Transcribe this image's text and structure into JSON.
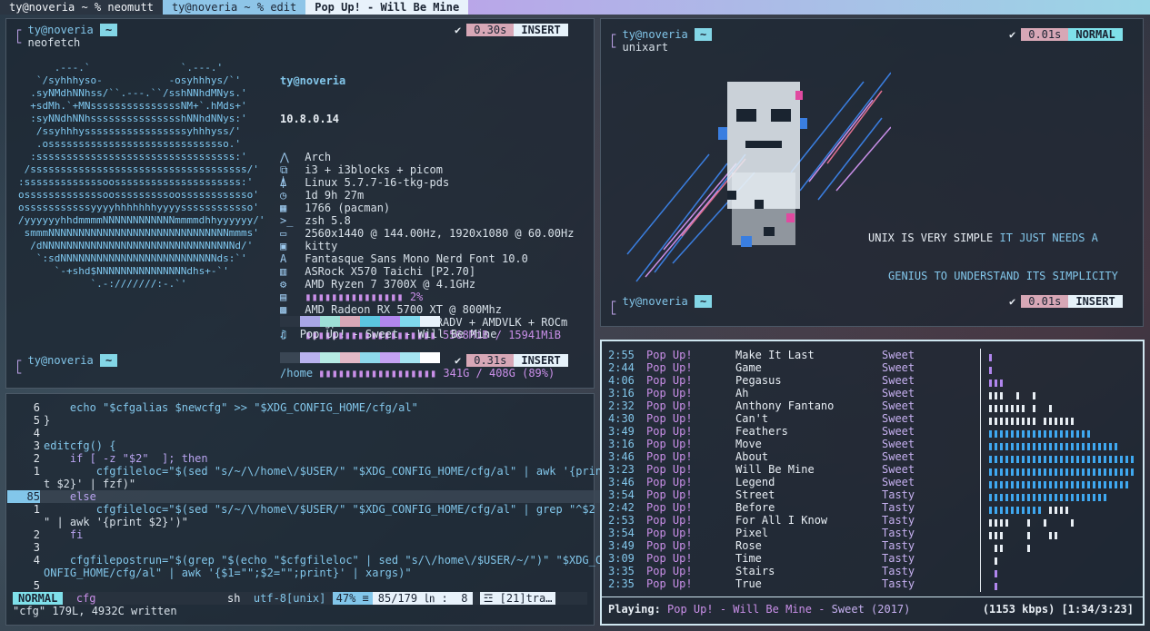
{
  "tabs": [
    {
      "label": "ty@noveria ~ % neomutt"
    },
    {
      "label": "ty@noveria ~ % edit"
    },
    {
      "label": "Pop Up! - Will Be Mine"
    }
  ],
  "colors": {
    "accent": "#82c6ea",
    "purple": "#c98fe8",
    "pink": "#d7a7b6"
  },
  "neofetch_pane": {
    "prompt_user": "ty@noveria",
    "prompt_dir": "~",
    "command": "neofetch",
    "time": "0.30s",
    "mode": "INSERT",
    "prompt2_user": "ty@noveria",
    "prompt2_dir": "~",
    "time2": "0.31s",
    "mode2": "INSERT",
    "check": "✔",
    "art": [
      "      .---.`               `.---.'",
      "   `/syhhhyso-           -osyhhhys/`'",
      "  .syNMdhNNhss/``.---.``/sshNNhdMNys.'",
      "  +sdMh.`+MNsssssssssssssssNM+`.hMds+'",
      "  :syNNdhNNhssssssssssssssshNNhdNNys:'",
      "   /ssyhhhysssssssssssssssssyhhhyss/'",
      "   .ossssssssssssssssssssssssssssso.'",
      "  :sssssssssssssssssssssssssssssssss:'",
      " /ssssssssssssssssssssssssssssssssssss/'",
      ":sssssssssssssoosssssssssssssssssssss:'",
      "osssssssssssssoosssssssssoossssssssssso'",
      "osssssssssssyyyyhhhhhhhyyyyssssssssssso'",
      "/yyyyyyhhdmmmmNNNNNNNNNNNNmmmmdhhyyyyyy/'",
      " smmmNNNNNNNNNNNNNNNNNNNNNNNNNNNNNNmmms'",
      "  /dNNNNNNNNNNNNNNNNNNNNNNNNNNNNNNNNd/'",
      "   `:sdNNNNNNNNNNNNNNNNNNNNNNNNNNds:`'",
      "      `-+shd$NNNNNNNNNNNNNNNdhs+-`'",
      "            `.-:///////:-.`'"
    ],
    "user_host": "ty@noveria",
    "version": "10.8.0.14",
    "info": [
      {
        "icon": "⋀",
        "value": "Arch"
      },
      {
        "icon": "⧉",
        "value": "i3 + i3blocks + picom"
      },
      {
        "icon": "⍋",
        "value": "Linux 5.7.7-16-tkg-pds"
      },
      {
        "icon": "◷",
        "value": "1d 9h 27m"
      },
      {
        "icon": "▦",
        "value": "1766 (pacman)"
      },
      {
        "icon": ">_",
        "value": "zsh 5.8"
      },
      {
        "icon": "▭",
        "value": "2560x1440 @ 144.00Hz, 1920x1080 @ 60.00Hz"
      },
      {
        "icon": "▣",
        "value": "kitty"
      },
      {
        "icon": "A",
        "value": "Fantasque Sans Mono Nerd Font 10.0"
      },
      {
        "icon": "▥",
        "value": "ASRock X570 Taichi [P2.70]"
      },
      {
        "icon": "⚙",
        "value": "AMD Ryzen 7 3700X @ 4.1GHz"
      },
      {
        "icon": "▤",
        "value": "▮▮▮▮▮▮▮▮▮▮▮▮▮▮▮ 2%"
      },
      {
        "icon": "▩",
        "value": "AMD Radeon RX 5700 XT @ 800Mhz"
      },
      {
        "icon": "◉",
        "value": "amdgpu + RadeonSI + RADV + AMDVLK + ROCm"
      },
      {
        "icon": "▯",
        "value": "▮▮▮▮▮▮▮▮▮▮▮▮▮▮▮▮▮▮▮▮ 5568MiB / 15941MiB"
      }
    ],
    "home_label": "/home",
    "home_value": "▮▮▮▮▮▮▮▮▮▮▮▮▮▮▮▮▮▮ 341G / 408G (89%)",
    "palette1": [
      "#2b3542",
      "#a8a6e6",
      "#9edfd6",
      "#d7a7b6",
      "#5bc6e0",
      "#b186ee",
      "#7fd8ec",
      "#e8f2fb"
    ],
    "palette2": [
      "#3a4654",
      "#b9b2ee",
      "#b6ece4",
      "#e3b9c6",
      "#8ed9ec",
      "#c4a2f2",
      "#a6e6f2",
      "#ffffff"
    ],
    "now_playing_icon": "♫",
    "now_playing": "Pop Up! - Sweet - Will Be Mine"
  },
  "unixart_pane": {
    "prompt_user": "ty@noveria",
    "prompt_dir": "~",
    "command": "unixart",
    "time": "0.01s",
    "mode": "NORMAL",
    "prompt2_user": "ty@noveria",
    "prompt2_dir": "~",
    "time2": "0.01s",
    "mode2": "INSERT",
    "quote_a": "UNIX IS VERY SIMPLE",
    "quote_b": "IT JUST NEEDS A",
    "quote_c": "GENIUS TO UNDERSTAND ITS SIMPLICITY"
  },
  "editor": {
    "lines": [
      {
        "n": "6",
        "html": "    echo \"$cfgalias $newcfg\" >> \"$XDG_CONFIG_HOME/cfg/al\""
      },
      {
        "n": "5",
        "html": "}"
      },
      {
        "n": "4",
        "html": ""
      },
      {
        "n": "3",
        "html": "editcfg() {"
      },
      {
        "n": "2",
        "html": "    if [ -z \"$2\"  ]; then"
      },
      {
        "n": "1",
        "html": "        cfgfileloc=\"$(sed \"s/~/\\/home\\/$USER/\" \"$XDG_CONFIG_HOME/cfg/al\" | awk '{prin"
      },
      {
        "n": "",
        "html": "t $2}' | fzf)\""
      },
      {
        "n": "85",
        "html": "    else"
      },
      {
        "n": "1",
        "html": "        cfgfileloc=\"$(sed \"s/~/\\/home\\/$USER/\" \"$XDG_CONFIG_HOME/cfg/al\" | grep \"^$2"
      },
      {
        "n": "",
        "html": "\" | awk '{print $2}')\""
      },
      {
        "n": "2",
        "html": "    fi"
      },
      {
        "n": "3",
        "html": ""
      },
      {
        "n": "4",
        "html": "    cfgfilepostrun=\"$(grep \"$(echo \"$cfgfileloc\" | sed \"s/\\/home\\/$USER/~/\")\" \"$XDG_C"
      },
      {
        "n": "",
        "html": "ONFIG_HOME/cfg/al\" | awk '{$1=\"\";$2=\"\";print}' | xargs)\""
      },
      {
        "n": "5",
        "html": ""
      }
    ],
    "status_mode": "NORMAL",
    "status_file": "cfg",
    "status_ft": "sh",
    "status_enc": "utf-8[unix]",
    "status_pct": "47% ≡",
    "status_pos": "85/179 ㏑ :  8",
    "status_extra": "☲ [21]tra…",
    "message": "\"cfg\" 179L, 4932C written"
  },
  "player": {
    "tracks": [
      {
        "time": "2:55",
        "artist": "Pop Up!",
        "title": "Make It Last",
        "album": "Sweet"
      },
      {
        "time": "2:44",
        "artist": "Pop Up!",
        "title": "Game",
        "album": "Sweet"
      },
      {
        "time": "4:06",
        "artist": "Pop Up!",
        "title": "Pegasus",
        "album": "Sweet"
      },
      {
        "time": "3:16",
        "artist": "Pop Up!",
        "title": "Ah",
        "album": "Sweet"
      },
      {
        "time": "2:32",
        "artist": "Pop Up!",
        "title": "Anthony Fantano",
        "album": "Sweet"
      },
      {
        "time": "4:30",
        "artist": "Pop Up!",
        "title": "Can't",
        "album": "Sweet"
      },
      {
        "time": "3:49",
        "artist": "Pop Up!",
        "title": "Feathers",
        "album": "Sweet"
      },
      {
        "time": "3:16",
        "artist": "Pop Up!",
        "title": "Move",
        "album": "Sweet"
      },
      {
        "time": "3:46",
        "artist": "Pop Up!",
        "title": "About",
        "album": "Sweet"
      },
      {
        "time": "3:23",
        "artist": "Pop Up!",
        "title": "Will Be Mine",
        "album": "Sweet"
      },
      {
        "time": "3:46",
        "artist": "Pop Up!",
        "title": "Legend",
        "album": "Sweet"
      },
      {
        "time": "3:54",
        "artist": "Pop Up!",
        "title": "Street",
        "album": "Tasty"
      },
      {
        "time": "2:42",
        "artist": "Pop Up!",
        "title": "Before",
        "album": "Tasty"
      },
      {
        "time": "2:53",
        "artist": "Pop Up!",
        "title": "For All I Know",
        "album": "Tasty"
      },
      {
        "time": "3:54",
        "artist": "Pop Up!",
        "title": "Pixel",
        "album": "Tasty"
      },
      {
        "time": "3:49",
        "artist": "Pop Up!",
        "title": "Rose",
        "album": "Tasty"
      },
      {
        "time": "3:09",
        "artist": "Pop Up!",
        "title": "Time",
        "album": "Tasty"
      },
      {
        "time": "3:35",
        "artist": "Pop Up!",
        "title": "Stairs",
        "album": "Tasty"
      },
      {
        "time": "2:35",
        "artist": "Pop Up!",
        "title": "True",
        "album": "Tasty"
      }
    ],
    "playing_label": "Playing:",
    "playing_track": "Pop Up! - Will Be Mine",
    "playing_sep": " - ",
    "playing_album": "Sweet (2017)",
    "playing_status": "(1153 kbps) [1:34/3:23]"
  }
}
